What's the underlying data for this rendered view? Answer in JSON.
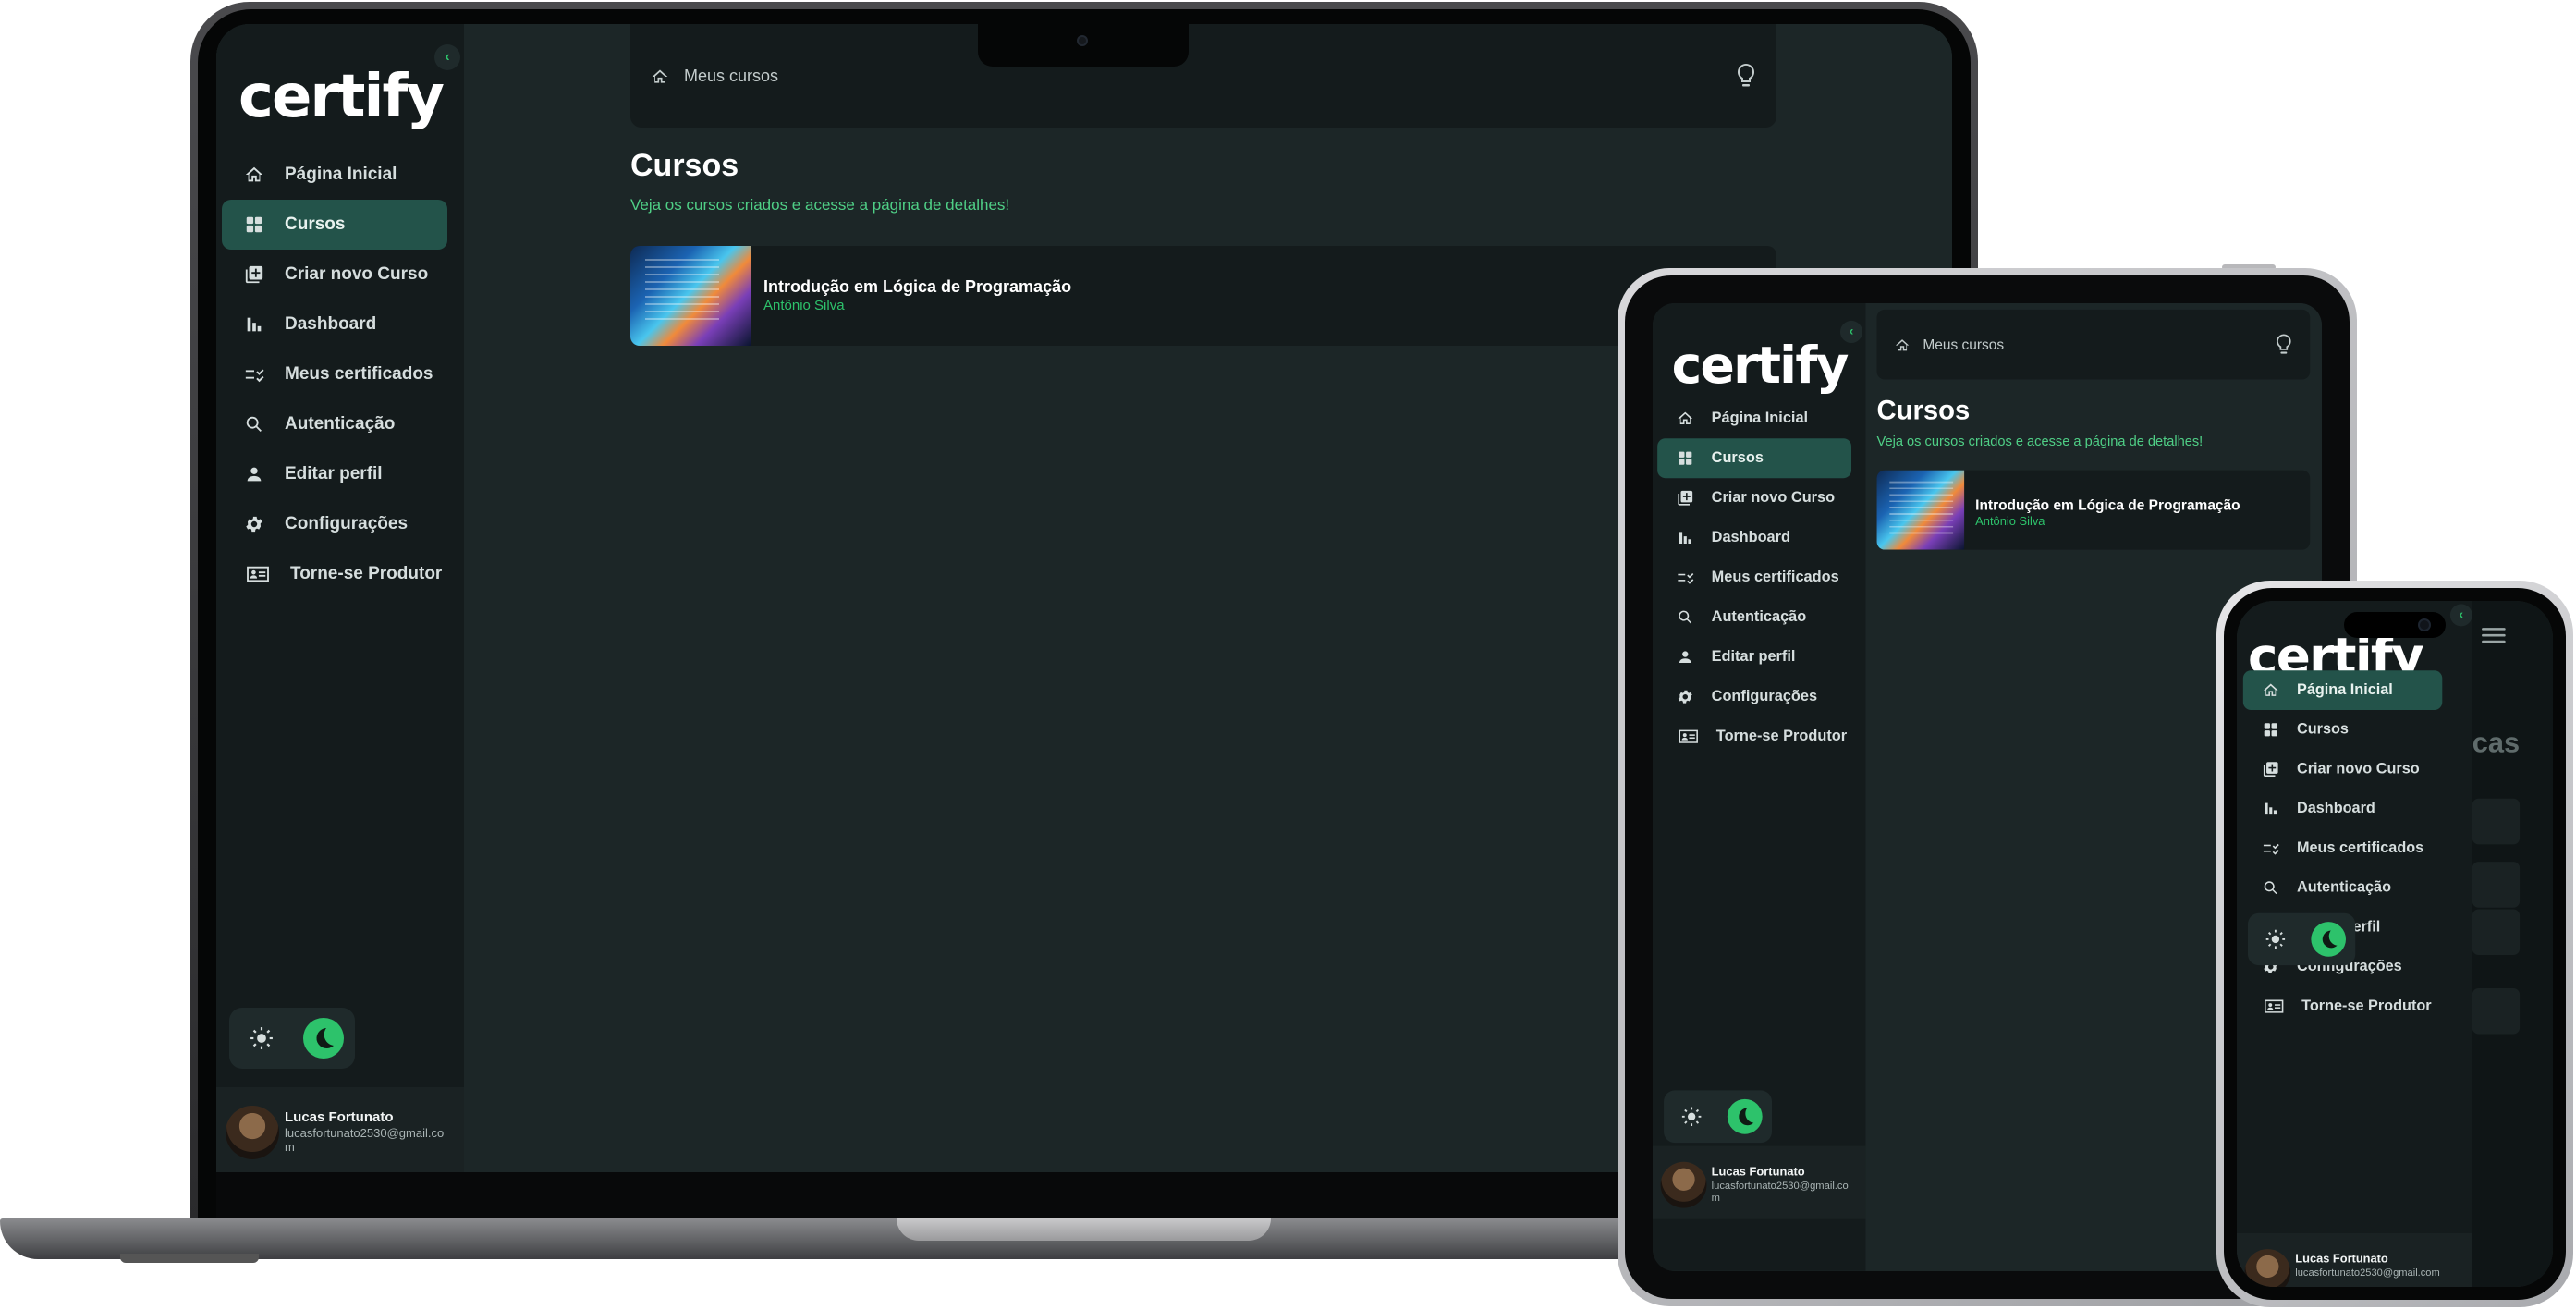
{
  "app": {
    "logo": "certify",
    "collapse_icon": "‹",
    "nav": [
      {
        "label": "Página Inicial",
        "icon": "home-icon"
      },
      {
        "label": "Cursos",
        "icon": "grid-icon"
      },
      {
        "label": "Criar novo Curso",
        "icon": "add-course-icon"
      },
      {
        "label": "Dashboard",
        "icon": "bar-chart-icon"
      },
      {
        "label": "Meus certificados",
        "icon": "checklist-icon"
      },
      {
        "label": "Autenticação",
        "icon": "search-icon"
      },
      {
        "label": "Editar perfil",
        "icon": "user-icon"
      },
      {
        "label": "Configurações",
        "icon": "gear-icon"
      },
      {
        "label": "Torne-se Produtor",
        "icon": "id-card-icon"
      }
    ],
    "user": {
      "name": "Lucas Fortunato",
      "email": "lucasfortunato2530@gmail.com"
    },
    "breadcrumb": "Meus cursos",
    "page_title": "Cursos",
    "page_subtitle": "Veja os cursos criados e acesse a página de detalhes!",
    "course": {
      "title": "Introdução em Lógica de Programação",
      "author": "Antônio Silva"
    },
    "colors": {
      "accent": "#2dc26b",
      "sidebar": "#141b1c",
      "background": "#1c2627",
      "active_item": "#23534a"
    }
  },
  "phone": {
    "peek_text": "cas"
  }
}
